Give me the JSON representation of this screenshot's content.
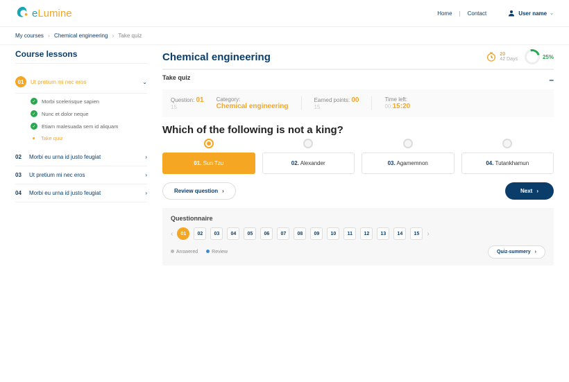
{
  "brand": {
    "e": "e",
    "rest": "Lumine"
  },
  "nav": {
    "home": "Home",
    "contact": "Contact",
    "user": "User name"
  },
  "crumbs": {
    "root": "My courses",
    "course": "Chemical engineering",
    "page": "Take quiz"
  },
  "sidebar": {
    "title": "Course lessons",
    "lessons": [
      {
        "num": "01",
        "label": "Ut pretium mi nec eros",
        "active": true
      },
      {
        "num": "02",
        "label": "Morbi eu urna id justo feugiat"
      },
      {
        "num": "03",
        "label": "Ut pretium mi nec eros"
      },
      {
        "num": "04",
        "label": "Morbi eu urna id justo feugiat"
      }
    ],
    "subs": [
      {
        "label": "Morbi scelerisque sapien"
      },
      {
        "label": "Nunc et dolor neque"
      },
      {
        "label": "Etiam malesuada sem id aliquam"
      },
      {
        "label": "Take quiz",
        "active": true
      }
    ]
  },
  "content": {
    "title": "Chemical engineering",
    "days": {
      "value": "20",
      "label": "42 Days"
    },
    "progress": "25%",
    "section": "Take quiz",
    "meta": {
      "question_label": "Question:",
      "question_cur": "01",
      "question_tot": "15",
      "category_label": "Category:",
      "category_value": "Chemical engineering",
      "earned_label": "Earned points:",
      "earned_cur": "00",
      "earned_tot": "15",
      "time_label": "Time left:",
      "time_hh": "00:",
      "time_rest": "15:20"
    },
    "question": "Which of the following is not a king?",
    "options": [
      {
        "num": "01.",
        "label": "Sun Tzu",
        "selected": true
      },
      {
        "num": "02.",
        "label": "Alexander"
      },
      {
        "num": "03.",
        "label": "Agamemnon"
      },
      {
        "num": "04.",
        "label": "Tutankhamun"
      }
    ],
    "actions": {
      "review": "Review question",
      "next": "Next"
    },
    "qnav": {
      "title": "Questionnaire",
      "nums": [
        "01",
        "02",
        "03",
        "04",
        "05",
        "06",
        "07",
        "08",
        "09",
        "10",
        "11",
        "12",
        "13",
        "14",
        "15"
      ],
      "legend_answered": "Answered",
      "legend_review": "Review",
      "summary": "Quiz-summery"
    }
  }
}
